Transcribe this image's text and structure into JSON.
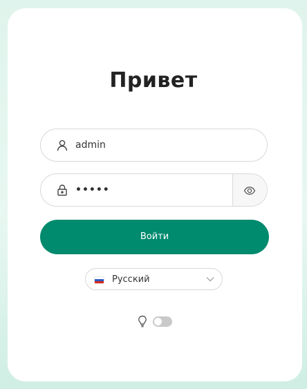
{
  "login": {
    "title": "Привет",
    "username": {
      "value": "admin",
      "icon": "user-icon"
    },
    "password": {
      "value": "•••••",
      "icon": "lock-icon",
      "toggle_icon": "eye-icon"
    },
    "submit_label": "Войти",
    "language": {
      "selected": "Русский",
      "flag": "flag-ru-icon"
    },
    "theme": {
      "icon": "lightbulb-icon",
      "dark_mode": false
    }
  },
  "colors": {
    "accent": "#008a6e",
    "background": "#dff4ec",
    "card": "#ffffff",
    "border": "#d8d8d8"
  }
}
